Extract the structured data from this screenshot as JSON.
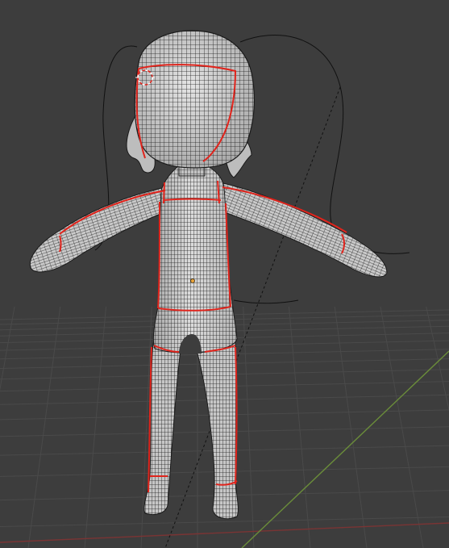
{
  "viewport": {
    "mode": "3d-viewport",
    "shading": "wireframe-on-solid",
    "background_color": "#3d3d3d",
    "grid_line_color": "#4a4a4a",
    "x_axis_color": "#7a3434",
    "y_axis_color": "#6a8c3a"
  },
  "scene": {
    "object_kind": "character-mesh",
    "mesh_surface_color": "#cfcfcf",
    "mesh_wire_color": "#1c1c1c",
    "seam_color": "#e0241c",
    "object_origin_color": "#e8a33a",
    "curve_color": "#111111",
    "cursor_icon": "3d-cursor-icon"
  }
}
